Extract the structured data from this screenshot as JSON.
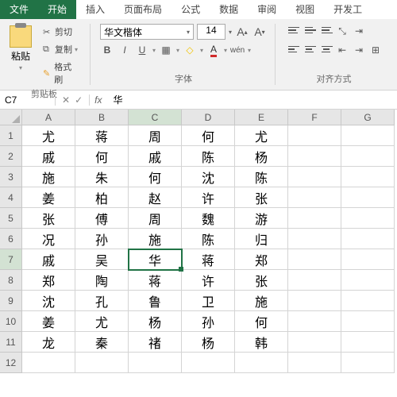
{
  "tabs": [
    "文件",
    "开始",
    "插入",
    "页面布局",
    "公式",
    "数据",
    "审阅",
    "视图",
    "开发工"
  ],
  "clipboard": {
    "paste": "粘贴",
    "cut": "剪切",
    "copy": "复制",
    "brush": "格式刷",
    "label": "剪贴板"
  },
  "font": {
    "name": "华文楷体",
    "size": "14",
    "label": "字体",
    "bold": "B",
    "italic": "I",
    "underline": "U",
    "wen": "wén"
  },
  "align": {
    "label": "对齐方式"
  },
  "cellref": "C7",
  "fx": "fx",
  "formula": "华",
  "cols": [
    "A",
    "B",
    "C",
    "D",
    "E",
    "F",
    "G"
  ],
  "rows": [
    "1",
    "2",
    "3",
    "4",
    "5",
    "6",
    "7",
    "8",
    "9",
    "10",
    "11",
    "12"
  ],
  "selected": {
    "row": 7,
    "col": "C"
  },
  "data": [
    [
      "尤",
      "蒋",
      "周",
      "何",
      "尤",
      "",
      ""
    ],
    [
      "戚",
      "何",
      "戚",
      "陈",
      "杨",
      "",
      ""
    ],
    [
      "施",
      "朱",
      "何",
      "沈",
      "陈",
      "",
      ""
    ],
    [
      "姜",
      "柏",
      "赵",
      "许",
      "张",
      "",
      ""
    ],
    [
      "张",
      "傅",
      "周",
      "魏",
      "游",
      "",
      ""
    ],
    [
      "况",
      "孙",
      "施",
      "陈",
      "归",
      "",
      ""
    ],
    [
      "戚",
      "吴",
      "华",
      "蒋",
      "郑",
      "",
      ""
    ],
    [
      "郑",
      "陶",
      "蒋",
      "许",
      "张",
      "",
      ""
    ],
    [
      "沈",
      "孔",
      "鲁",
      "卫",
      "施",
      "",
      ""
    ],
    [
      "姜",
      "尤",
      "杨",
      "孙",
      "何",
      "",
      ""
    ],
    [
      "龙",
      "秦",
      "禇",
      "杨",
      "韩",
      "",
      ""
    ],
    [
      "",
      "",
      "",
      "",
      "",
      "",
      ""
    ]
  ]
}
